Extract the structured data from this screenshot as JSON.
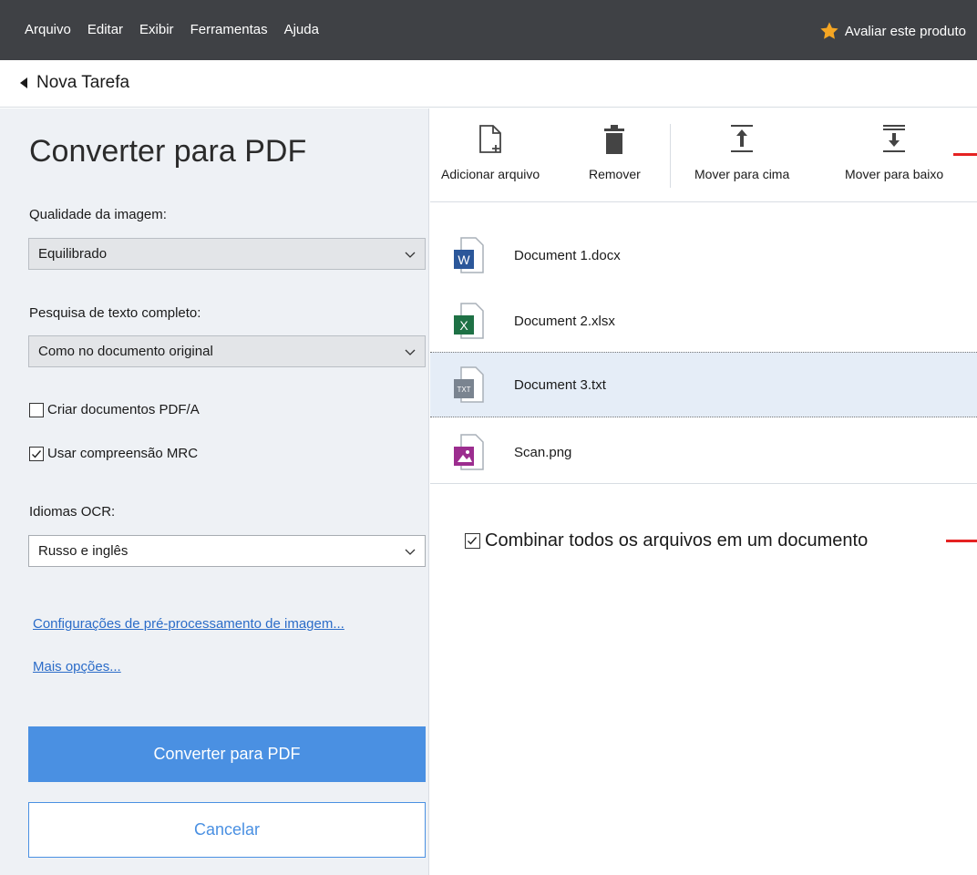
{
  "menu": {
    "items": [
      "Arquivo",
      "Editar",
      "Exibir",
      "Ferramentas",
      "Ajuda"
    ],
    "rate_label": "Avaliar este produto"
  },
  "nav": {
    "back_label": "Nova Tarefa"
  },
  "left_panel": {
    "title": "Converter para PDF",
    "image_quality": {
      "label": "Qualidade da imagem:",
      "value": "Equilibrado"
    },
    "text_search": {
      "label": "Pesquisa de texto completo:",
      "value": "Como no documento original"
    },
    "pdfa": {
      "label": "Criar documentos PDF/A",
      "checked": false
    },
    "mrc": {
      "label": "Usar compreensão MRC",
      "checked": true
    },
    "ocr": {
      "label": "Idiomas OCR:",
      "value": "Russo e inglês"
    },
    "link_preprocess": "Configurações de pré-processamento de imagem...",
    "link_more": "Mais opções...",
    "convert_button": "Converter para PDF",
    "cancel_button": "Cancelar"
  },
  "toolbar": {
    "add": "Adicionar arquivo",
    "remove": "Remover",
    "move_up": "Mover para cima",
    "move_down": "Mover para baixo"
  },
  "files": [
    {
      "name": "Document 1.docx",
      "icon": "word-file-icon",
      "badge": "W",
      "color": "#2b579a",
      "selected": false
    },
    {
      "name": "Document 2.xlsx",
      "icon": "excel-file-icon",
      "badge": "X",
      "color": "#1e7145",
      "selected": false
    },
    {
      "name": "Document 3.txt",
      "icon": "text-file-icon",
      "badge": "TXT",
      "color": "#7a8490",
      "selected": true
    },
    {
      "name": "Scan.png",
      "icon": "image-file-icon",
      "badge": "",
      "color": "#9c2d8f",
      "selected": false
    }
  ],
  "combine": {
    "label": "Combinar todos os arquivos em um documento",
    "checked": true
  },
  "colors": {
    "menubar": "#3f4145",
    "accent": "#4a90e2",
    "link": "#2b6cc8",
    "annotation_red": "#e52222",
    "star": "#f5a623"
  }
}
